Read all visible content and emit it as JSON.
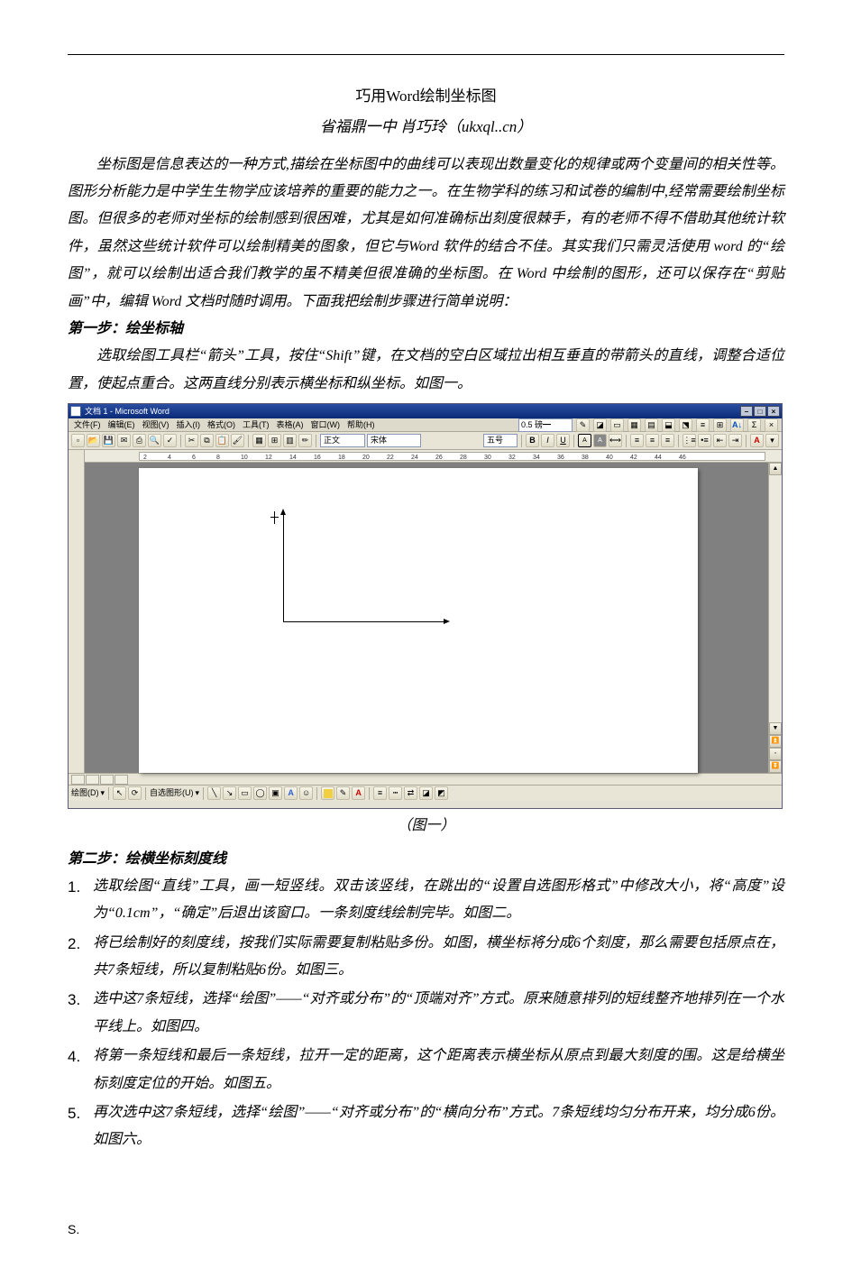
{
  "header_rule": true,
  "title": "巧用Word绘制坐标图",
  "subtitle": "省福鼎一中  肖巧玲（ukxql..cn）",
  "intro": "坐标图是信息表达的一种方式,描绘在坐标图中的曲线可以表现出数量变化的规律或两个变量间的相关性等。图形分析能力是中学生生物学应该培养的重要的能力之一。在生物学科的练习和试卷的编制中,经常需要绘制坐标图。但很多的老师对坐标的绘制感到很困难，尤其是如何准确标出刻度很棘手，有的老师不得不借助其他统计软件，虽然这些统计软件可以绘制精美的图象，但它与Word 软件的结合不佳。其实我们只需灵活使用 word 的“绘图”，就可以绘制出适合我们教学的虽不精美但很准确的坐标图。在 Word 中绘制的图形，还可以保存在“剪贴画”中，编辑 Word 文档时随时调用。下面我把绘制步骤进行简单说明：",
  "step1_heading": "第一步：绘坐标轴",
  "step1_body": "选取绘图工具栏“箭头”工具，按住“Shift”键，在文档的空白区域拉出相互垂直的带箭头的直线，调整合适位置，使起点重合。这两直线分别表示横坐标和纵坐标。如图一。",
  "figure1_caption": "（图一）",
  "step2_heading": "第二步：绘横坐标刻度线",
  "step2_items": [
    "选取绘图“直线”工具，画一短竖线。双击该竖线，在跳出的“设置自选图形格式”中修改大小，将“高度”设为“0.1cm”，“确定”后退出该窗口。一条刻度线绘制完毕。如图二。",
    "将已绘制好的刻度线，按我们实际需要复制粘贴多份。如图，横坐标将分成6个刻度，那么需要包括原点在，共7条短线，所以复制粘贴6份。如图三。",
    "选中这7条短线，选择“绘图”——“对齐或分布”的“顶端对齐”方式。原来随意排列的短线整齐地排列在一个水平线上。如图四。",
    "将第一条短线和最后一条短线，拉开一定的距离，这个距离表示横坐标从原点到最大刻度的围。这是给横坐标刻度定位的开始。如图五。",
    "再次选中这7条短线，选择“绘图”——“对齐或分布”的“横向分布”方式。7条短线均匀分布开来，均分成6份。如图六。"
  ],
  "footer": "S.",
  "word_shot": {
    "titlebar": "文档 1 - Microsoft Word",
    "win_buttons": [
      "–",
      "□",
      "×"
    ],
    "menu": [
      "文件(F)",
      "编辑(E)",
      "视图(V)",
      "插入(I)",
      "格式(O)",
      "工具(T)",
      "表格(A)",
      "窗口(W)",
      "帮助(H)"
    ],
    "toolbar2_fields": {
      "style": "正文",
      "font": "宋体",
      "size": "五号"
    },
    "ruler_numbers": [
      "2",
      "4",
      "6",
      "8",
      "10",
      "12",
      "14",
      "16",
      "18",
      "20",
      "22",
      "24",
      "26",
      "28",
      "30",
      "32",
      "34",
      "36",
      "38",
      "40",
      "42",
      "44",
      "46"
    ],
    "draw_toolbar_label1": "绘图(D)",
    "draw_toolbar_label2": "自选图形(U)"
  }
}
